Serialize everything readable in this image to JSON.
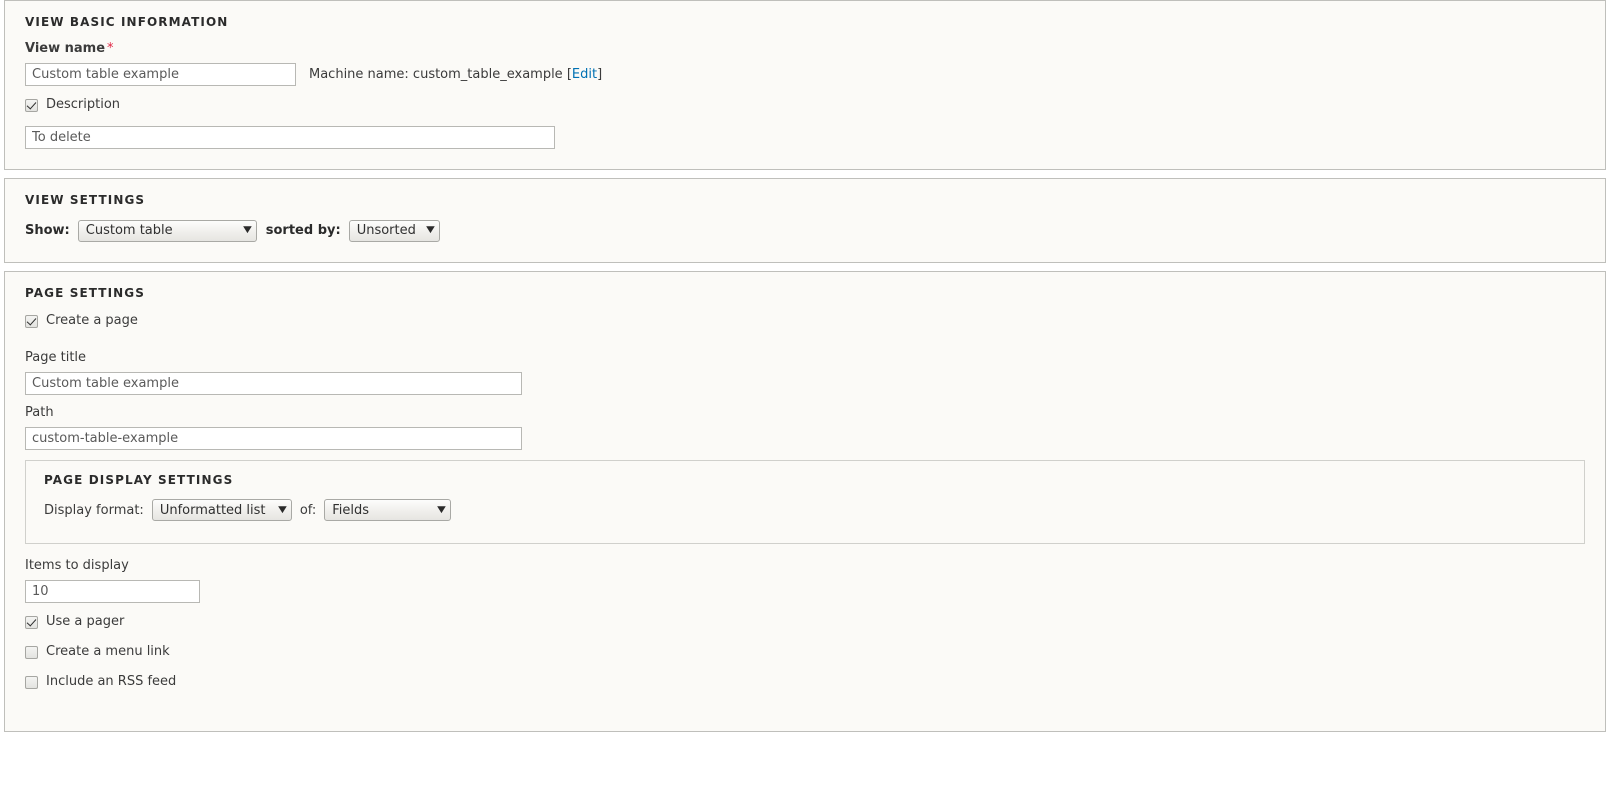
{
  "basic_information": {
    "legend": "View basic information",
    "view_name": {
      "label": "View name",
      "required_mark": "*",
      "value": "Custom table example",
      "placeholder": "View name"
    },
    "machine_name": {
      "prefix": "Machine name: custom_table_example [",
      "edit_link": "Edit",
      "suffix": "]"
    },
    "description_toggle": {
      "label": "Description",
      "checked": true
    },
    "description_field": {
      "value": "To delete",
      "placeholder": "Description"
    }
  },
  "view_settings": {
    "legend": "View settings",
    "show_label": "Show:",
    "show_value": "Custom table",
    "sorted_by_label": "sorted by:",
    "sorted_by_value": "Unsorted"
  },
  "page_settings": {
    "legend": "Page settings",
    "create_page": {
      "label": "Create a page",
      "checked": true
    },
    "page_title": {
      "label": "Page title",
      "value": "Custom table example",
      "placeholder": "Page title"
    },
    "path": {
      "label": "Path",
      "value": "custom-table-example",
      "placeholder": "Path"
    },
    "display_settings": {
      "legend": "Page display settings",
      "display_format_label": "Display format:",
      "display_format_value": "Unformatted list",
      "of_label": "of:",
      "of_value": "Fields"
    },
    "items_to_display": {
      "label": "Items to display",
      "value": "10",
      "placeholder": "Items to display"
    },
    "use_pager": {
      "label": "Use a pager",
      "checked": true
    },
    "create_menu_link": {
      "label": "Create a menu link",
      "checked": false
    },
    "include_rss_feed": {
      "label": "Include an RSS feed",
      "checked": false
    }
  },
  "icons": {
    "dropdown_arrow": "▼"
  },
  "colors": {
    "panel_background": "#fbfaf7",
    "panel_border": "#bfbfbb",
    "link": "#0071b3",
    "required": "#e02443",
    "text": "#3b3b3b"
  }
}
